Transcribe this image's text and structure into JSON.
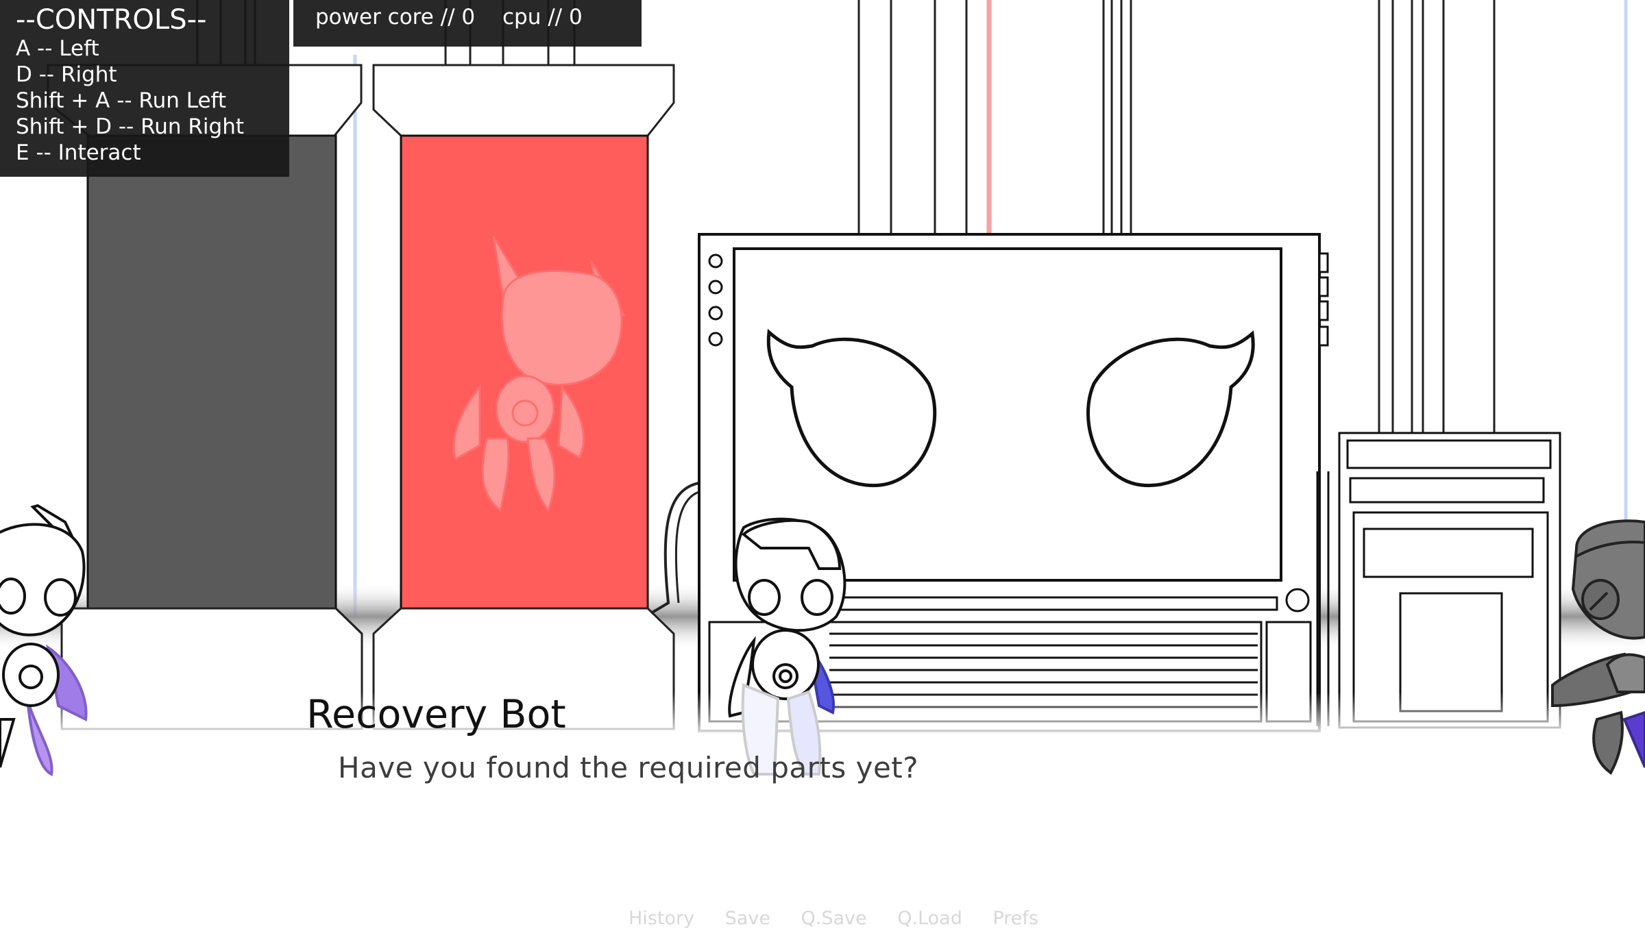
{
  "hud": {
    "controls": {
      "title": "--CONTROLS--",
      "lines": [
        "A -- Left",
        "D -- Right",
        "Shift + A -- Run Left",
        "Shift + D -- Run Right",
        "E -- Interact"
      ]
    },
    "stats": {
      "power_core": "power core // 0",
      "cpu": "cpu // 0"
    }
  },
  "dialogue": {
    "speaker": "Recovery Bot",
    "text": "Have you found the required parts yet?"
  },
  "quick_menu": [
    "History",
    "Save",
    "Q.Save",
    "Q.Load",
    "Prefs"
  ],
  "colors": {
    "pod_red": "#ff5c5c",
    "pod_dark": "#5a5a5a",
    "accent_purple": "#a07ce8",
    "accent_blue": "#5656e0",
    "laser_red": "#f4a2a2",
    "pipe_blue": "#c6d6f4"
  }
}
